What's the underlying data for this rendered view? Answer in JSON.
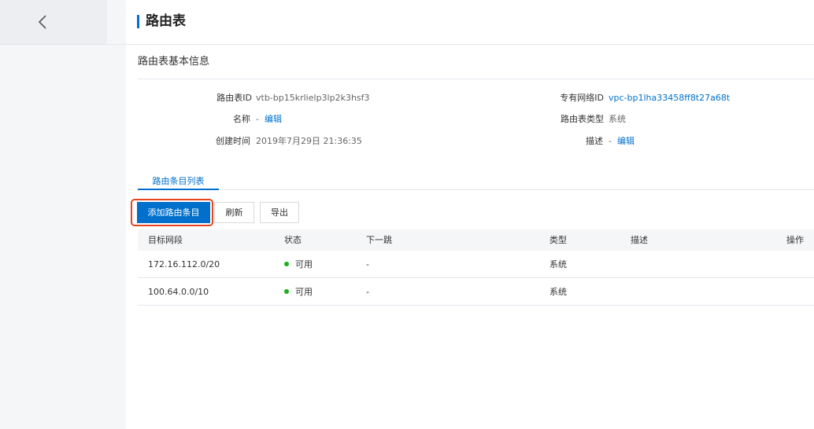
{
  "page": {
    "title": "路由表"
  },
  "basic_info": {
    "section_title": "路由表基本信息",
    "route_table_id_label": "路由表ID",
    "route_table_id_value": "vtb-bp15krlielp3lp2k3hsf3",
    "vpc_id_label": "专有网络ID",
    "vpc_id_value": "vpc-bp1lha33458ff8t27a68t",
    "name_label": "名称",
    "name_value": "-",
    "name_edit": "编辑",
    "type_label": "路由表类型",
    "type_value": "系统",
    "created_label": "创建时间",
    "created_value": "2019年7月29日 21:36:35",
    "desc_label": "描述",
    "desc_value": "-",
    "desc_edit": "编辑"
  },
  "tabs": [
    {
      "label": "路由条目列表",
      "active": true
    }
  ],
  "toolbar": {
    "add_label": "添加路由条目",
    "refresh_label": "刷新",
    "export_label": "导出"
  },
  "table": {
    "headers": [
      "目标网段",
      "状态",
      "下一跳",
      "类型",
      "描述",
      "操作"
    ],
    "rows": [
      {
        "cidr": "172.16.112.0/20",
        "status": "可用",
        "next_hop": "-",
        "type": "系统",
        "desc": "",
        "action": ""
      },
      {
        "cidr": "100.64.0.0/10",
        "status": "可用",
        "next_hop": "-",
        "type": "系统",
        "desc": "",
        "action": ""
      }
    ]
  },
  "colors": {
    "accent": "#0070cc",
    "status_ok": "#1ab01a",
    "highlight": "#e8431f"
  },
  "icons": {
    "back": "chevron-left-icon"
  }
}
